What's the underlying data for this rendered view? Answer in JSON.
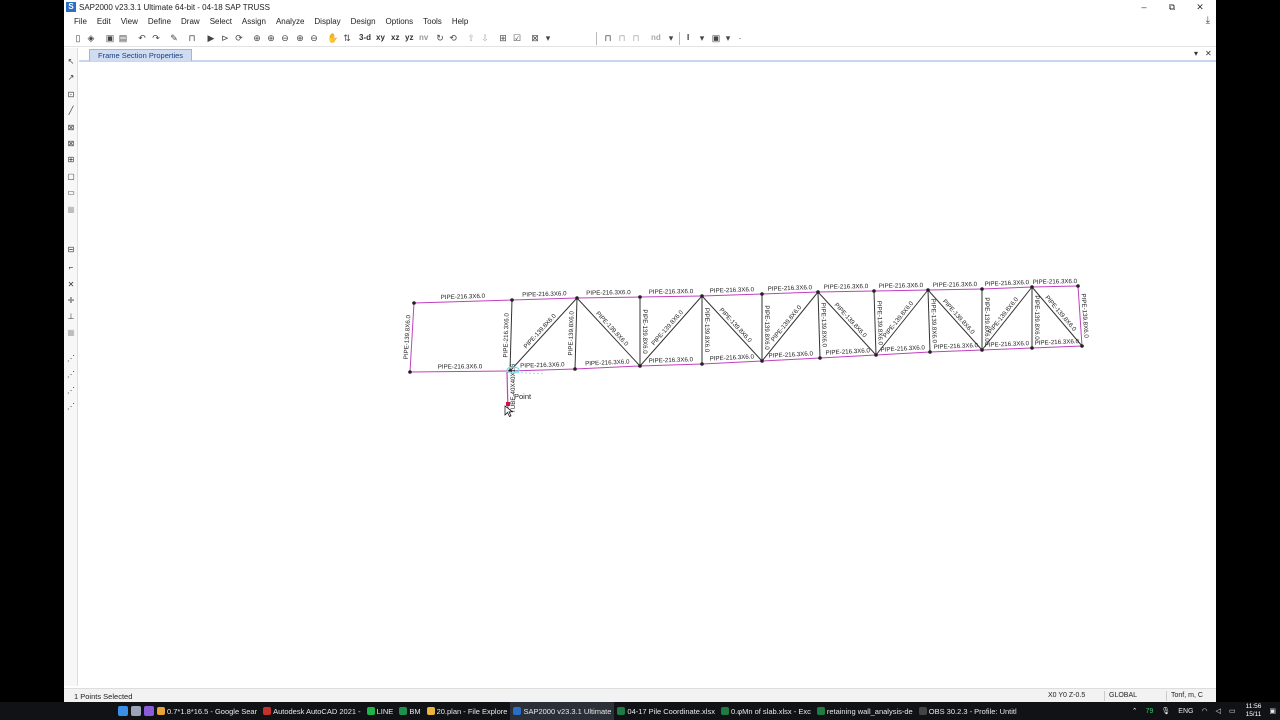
{
  "window": {
    "title": "SAP2000 v23.3.1 Ultimate 64-bit - 04-18 SAP TRUSS",
    "app_icon_letter": "S",
    "minimize": "–",
    "maximize": "⧉",
    "close": "✕"
  },
  "menu": [
    "File",
    "Edit",
    "View",
    "Define",
    "Draw",
    "Select",
    "Assign",
    "Analyze",
    "Display",
    "Design",
    "Options",
    "Tools",
    "Help"
  ],
  "toolbar": {
    "view_3d": "3-d",
    "view_xy": "xy",
    "view_xz": "xz",
    "view_yz": "yz",
    "view_nv": "nv",
    "nd": "nd",
    "text_tool": "I"
  },
  "tab": {
    "label": "Frame Section Properties",
    "dropdown": "▾",
    "close": "✕"
  },
  "truss": {
    "top_chord_labels": [
      "PIPE-216.3X6.0",
      "PIPE-216.3X6.0",
      "PIPE-216.3X6.0",
      "PIPE-216.3X6.0",
      "PIPE-216.3X6.0",
      "PIPE-216.3X6.0",
      "PIPE-216.3X6.0",
      "PIPE-216.3X6.0",
      "PIPE-216.3X6.0",
      "PIPE-216.3X6.0",
      "PIPE-216.3X6.0"
    ],
    "bottom_chord_labels": [
      "PIPE-216.3X6.0",
      "PIPE-216.3X6.0",
      "PIPE-216.3X6.0",
      "PIPE-216.3X6.0",
      "PIPE-216.3X6.0",
      "PIPE-216.3X6.0",
      "PIPE-216.3X6.0",
      "PIPE-216.3X6.0",
      "PIPE-216.3X6.0",
      "PIPE-216.3X6.0",
      "PIPE-216.3X6.0"
    ],
    "web_label": "PIPE-139.8X6.0",
    "post_label": "PIPE-139.8X6.0",
    "second_post_label": "PIPE-216.3X6.0",
    "support_label": "TUBE-40X40X1.6",
    "point_label": "Point"
  },
  "status": {
    "selection": "1 Points Selected",
    "coords": "X0  Y0  Z-0.5",
    "coord_system": "GLOBAL",
    "units": "Tonf, m, C"
  },
  "taskbar": {
    "apps": [
      {
        "label": "0.7*1.8*16.5 - Google Sear",
        "color": "#e8a33a"
      },
      {
        "label": "Autodesk AutoCAD 2021 -",
        "color": "#c8302e"
      },
      {
        "label": "LINE",
        "color": "#21b34b"
      },
      {
        "label": "BM",
        "color": "#1f8f4e"
      },
      {
        "label": "20.plan - File Explore",
        "color": "#e8b63a"
      },
      {
        "label": "SAP2000 v23.3.1 Ultimate",
        "color": "#2a6fc4"
      },
      {
        "label": "04-17 Pile Coordinate.xlsx",
        "color": "#1e7b45"
      },
      {
        "label": "0.φMn of slab.xlsx - Exc",
        "color": "#1e7b45"
      },
      {
        "label": "retaining wall_analysis-de",
        "color": "#1e7b45"
      },
      {
        "label": "OBS 30.2.3 - Profile: Untitl",
        "color": "#444444"
      }
    ],
    "tray_temp": "79",
    "language": "ENG",
    "time": "11:56",
    "date": "15/11"
  }
}
